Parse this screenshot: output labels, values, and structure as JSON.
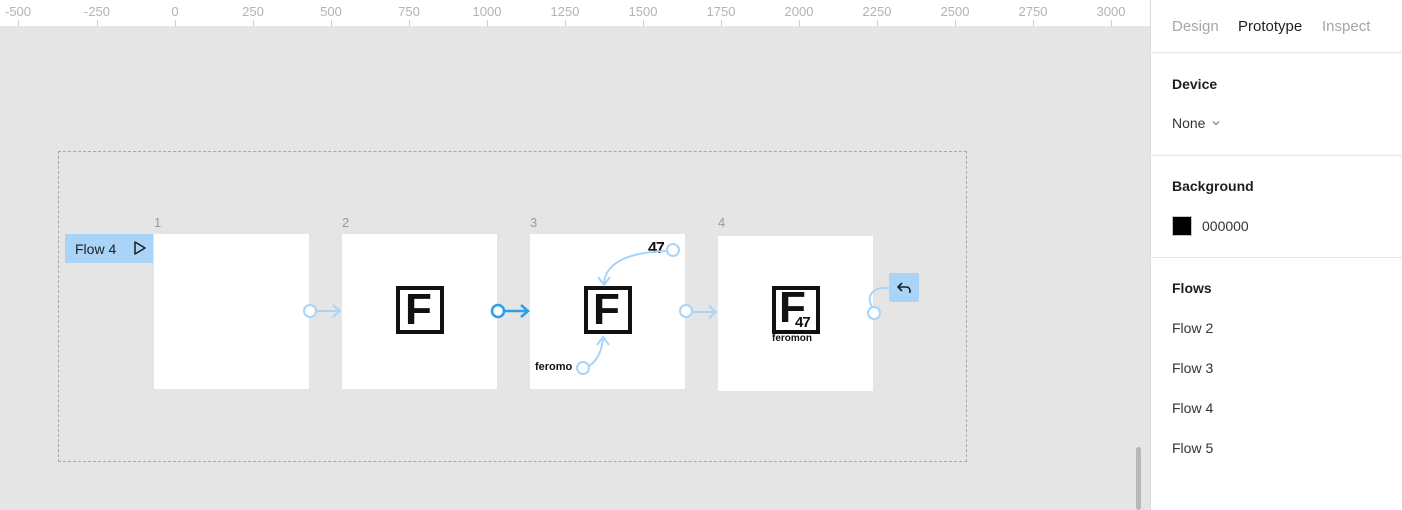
{
  "ruler": {
    "ticks": [
      "-500",
      "-250",
      "0",
      "250",
      "500",
      "750",
      "1000",
      "1250",
      "1500",
      "1750",
      "2000",
      "2250",
      "2500",
      "2750",
      "3000"
    ]
  },
  "canvas": {
    "flow_badge_label": "Flow 4",
    "frames": [
      {
        "number": "1"
      },
      {
        "number": "2"
      },
      {
        "number": "3",
        "overlay_text_top": "47",
        "overlay_text_bottom": "feromo"
      },
      {
        "number": "4",
        "logo_sub": "47",
        "logo_caption": "feromon"
      }
    ],
    "logo_letter": "F"
  },
  "panel": {
    "tabs": [
      "Design",
      "Prototype",
      "Inspect"
    ],
    "active_tab": "Prototype",
    "device": {
      "title": "Device",
      "value": "None"
    },
    "background": {
      "title": "Background",
      "hex": "000000",
      "color": "#000000"
    },
    "flows": {
      "title": "Flows",
      "items": [
        "Flow 2",
        "Flow 3",
        "Flow 4",
        "Flow 5"
      ]
    }
  },
  "colors": {
    "accent_blue": "#a9d4f7",
    "connector_blue": "#2d9ee8",
    "canvas_bg": "#e5e5e5"
  },
  "icons": [
    "play-icon",
    "chevron-down-icon",
    "back-arrow-icon"
  ]
}
